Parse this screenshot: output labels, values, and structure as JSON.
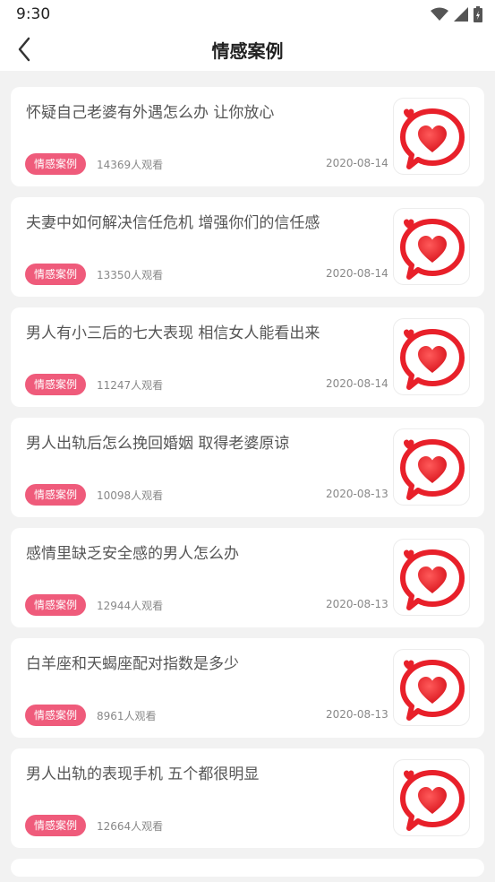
{
  "status_bar": {
    "time": "9:30",
    "icons": [
      "wifi-icon",
      "signal-icon",
      "battery-icon"
    ]
  },
  "header": {
    "title": "情感案例",
    "back_icon": "chevron-left-icon"
  },
  "colors": {
    "tag_bg": "#ef5b7b",
    "heart_red": "#e8202a",
    "background": "#f2f2f2"
  },
  "articles": [
    {
      "title": "怀疑自己老婆有外遇怎么办 让你放心",
      "tag": "情感案例",
      "views": "14369人观看",
      "date": "2020-08-14",
      "thumb_icon": "heart-chat-icon"
    },
    {
      "title": "夫妻中如何解决信任危机 增强你们的信任感",
      "tag": "情感案例",
      "views": "13350人观看",
      "date": "2020-08-14",
      "thumb_icon": "heart-chat-icon"
    },
    {
      "title": "男人有小三后的七大表现 相信女人能看出来",
      "tag": "情感案例",
      "views": "11247人观看",
      "date": "2020-08-14",
      "thumb_icon": "heart-chat-icon"
    },
    {
      "title": "男人出轨后怎么挽回婚姻 取得老婆原谅",
      "tag": "情感案例",
      "views": "10098人观看",
      "date": "2020-08-13",
      "thumb_icon": "heart-chat-icon"
    },
    {
      "title": "感情里缺乏安全感的男人怎么办",
      "tag": "情感案例",
      "views": "12944人观看",
      "date": "2020-08-13",
      "thumb_icon": "heart-chat-icon"
    },
    {
      "title": "白羊座和天蝎座配对指数是多少",
      "tag": "情感案例",
      "views": "8961人观看",
      "date": "2020-08-13",
      "thumb_icon": "heart-chat-icon"
    },
    {
      "title": "男人出轨的表现手机 五个都很明显",
      "tag": "情感案例",
      "views": "12664人观看",
      "date": "",
      "thumb_icon": "heart-chat-icon"
    }
  ]
}
